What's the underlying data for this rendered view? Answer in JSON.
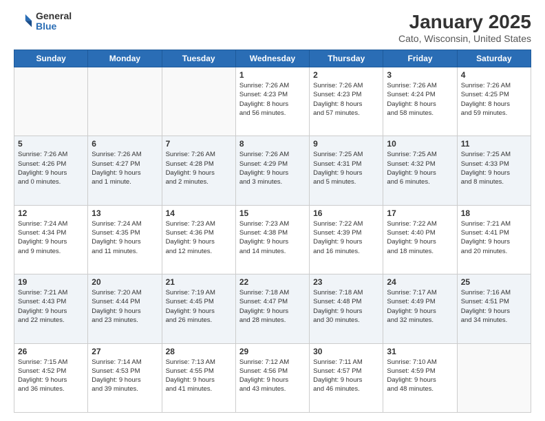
{
  "logo": {
    "general": "General",
    "blue": "Blue"
  },
  "header": {
    "month": "January 2025",
    "location": "Cato, Wisconsin, United States"
  },
  "days_of_week": [
    "Sunday",
    "Monday",
    "Tuesday",
    "Wednesday",
    "Thursday",
    "Friday",
    "Saturday"
  ],
  "weeks": [
    [
      {
        "day": "",
        "info": ""
      },
      {
        "day": "",
        "info": ""
      },
      {
        "day": "",
        "info": ""
      },
      {
        "day": "1",
        "info": "Sunrise: 7:26 AM\nSunset: 4:23 PM\nDaylight: 8 hours\nand 56 minutes."
      },
      {
        "day": "2",
        "info": "Sunrise: 7:26 AM\nSunset: 4:23 PM\nDaylight: 8 hours\nand 57 minutes."
      },
      {
        "day": "3",
        "info": "Sunrise: 7:26 AM\nSunset: 4:24 PM\nDaylight: 8 hours\nand 58 minutes."
      },
      {
        "day": "4",
        "info": "Sunrise: 7:26 AM\nSunset: 4:25 PM\nDaylight: 8 hours\nand 59 minutes."
      }
    ],
    [
      {
        "day": "5",
        "info": "Sunrise: 7:26 AM\nSunset: 4:26 PM\nDaylight: 9 hours\nand 0 minutes."
      },
      {
        "day": "6",
        "info": "Sunrise: 7:26 AM\nSunset: 4:27 PM\nDaylight: 9 hours\nand 1 minute."
      },
      {
        "day": "7",
        "info": "Sunrise: 7:26 AM\nSunset: 4:28 PM\nDaylight: 9 hours\nand 2 minutes."
      },
      {
        "day": "8",
        "info": "Sunrise: 7:26 AM\nSunset: 4:29 PM\nDaylight: 9 hours\nand 3 minutes."
      },
      {
        "day": "9",
        "info": "Sunrise: 7:25 AM\nSunset: 4:31 PM\nDaylight: 9 hours\nand 5 minutes."
      },
      {
        "day": "10",
        "info": "Sunrise: 7:25 AM\nSunset: 4:32 PM\nDaylight: 9 hours\nand 6 minutes."
      },
      {
        "day": "11",
        "info": "Sunrise: 7:25 AM\nSunset: 4:33 PM\nDaylight: 9 hours\nand 8 minutes."
      }
    ],
    [
      {
        "day": "12",
        "info": "Sunrise: 7:24 AM\nSunset: 4:34 PM\nDaylight: 9 hours\nand 9 minutes."
      },
      {
        "day": "13",
        "info": "Sunrise: 7:24 AM\nSunset: 4:35 PM\nDaylight: 9 hours\nand 11 minutes."
      },
      {
        "day": "14",
        "info": "Sunrise: 7:23 AM\nSunset: 4:36 PM\nDaylight: 9 hours\nand 12 minutes."
      },
      {
        "day": "15",
        "info": "Sunrise: 7:23 AM\nSunset: 4:38 PM\nDaylight: 9 hours\nand 14 minutes."
      },
      {
        "day": "16",
        "info": "Sunrise: 7:22 AM\nSunset: 4:39 PM\nDaylight: 9 hours\nand 16 minutes."
      },
      {
        "day": "17",
        "info": "Sunrise: 7:22 AM\nSunset: 4:40 PM\nDaylight: 9 hours\nand 18 minutes."
      },
      {
        "day": "18",
        "info": "Sunrise: 7:21 AM\nSunset: 4:41 PM\nDaylight: 9 hours\nand 20 minutes."
      }
    ],
    [
      {
        "day": "19",
        "info": "Sunrise: 7:21 AM\nSunset: 4:43 PM\nDaylight: 9 hours\nand 22 minutes."
      },
      {
        "day": "20",
        "info": "Sunrise: 7:20 AM\nSunset: 4:44 PM\nDaylight: 9 hours\nand 23 minutes."
      },
      {
        "day": "21",
        "info": "Sunrise: 7:19 AM\nSunset: 4:45 PM\nDaylight: 9 hours\nand 26 minutes."
      },
      {
        "day": "22",
        "info": "Sunrise: 7:18 AM\nSunset: 4:47 PM\nDaylight: 9 hours\nand 28 minutes."
      },
      {
        "day": "23",
        "info": "Sunrise: 7:18 AM\nSunset: 4:48 PM\nDaylight: 9 hours\nand 30 minutes."
      },
      {
        "day": "24",
        "info": "Sunrise: 7:17 AM\nSunset: 4:49 PM\nDaylight: 9 hours\nand 32 minutes."
      },
      {
        "day": "25",
        "info": "Sunrise: 7:16 AM\nSunset: 4:51 PM\nDaylight: 9 hours\nand 34 minutes."
      }
    ],
    [
      {
        "day": "26",
        "info": "Sunrise: 7:15 AM\nSunset: 4:52 PM\nDaylight: 9 hours\nand 36 minutes."
      },
      {
        "day": "27",
        "info": "Sunrise: 7:14 AM\nSunset: 4:53 PM\nDaylight: 9 hours\nand 39 minutes."
      },
      {
        "day": "28",
        "info": "Sunrise: 7:13 AM\nSunset: 4:55 PM\nDaylight: 9 hours\nand 41 minutes."
      },
      {
        "day": "29",
        "info": "Sunrise: 7:12 AM\nSunset: 4:56 PM\nDaylight: 9 hours\nand 43 minutes."
      },
      {
        "day": "30",
        "info": "Sunrise: 7:11 AM\nSunset: 4:57 PM\nDaylight: 9 hours\nand 46 minutes."
      },
      {
        "day": "31",
        "info": "Sunrise: 7:10 AM\nSunset: 4:59 PM\nDaylight: 9 hours\nand 48 minutes."
      },
      {
        "day": "",
        "info": ""
      }
    ]
  ]
}
